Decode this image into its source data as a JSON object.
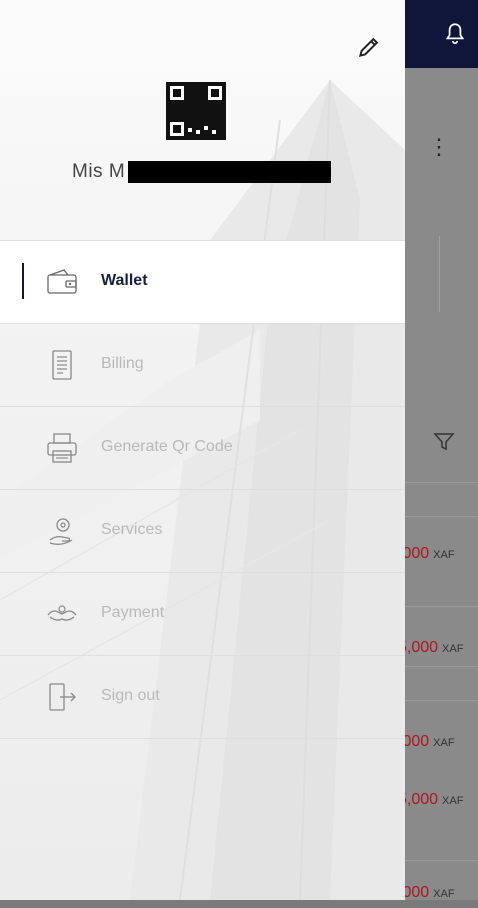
{
  "profile": {
    "name_visible": "Mis M",
    "edit_icon": "pencil-icon",
    "qr_icon": "qr-code-icon"
  },
  "menu": [
    {
      "label": "Wallet",
      "icon": "wallet-icon",
      "active": true
    },
    {
      "label": "Billing",
      "icon": "billing-icon",
      "active": false
    },
    {
      "label": "Generate Qr Code",
      "icon": "printer-icon",
      "active": false
    },
    {
      "label": "Services",
      "icon": "services-icon",
      "active": false
    },
    {
      "label": "Payment",
      "icon": "payment-icon",
      "active": false
    },
    {
      "label": "Sign out",
      "icon": "sign-out-icon",
      "active": false
    }
  ],
  "background": {
    "amounts": [
      {
        "value": ",000",
        "currency": "XAF"
      },
      {
        "value": "5,000",
        "currency": "XAF"
      },
      {
        "value": ",000",
        "currency": "XAF"
      },
      {
        "value": "5,000",
        "currency": "XAF"
      },
      {
        "value": ",000",
        "currency": "XAF"
      }
    ]
  },
  "colors": {
    "topbar": "#10163a",
    "accent": "#10163a",
    "amount": "#b0161d",
    "inactive_label": "#b9b9b9"
  }
}
